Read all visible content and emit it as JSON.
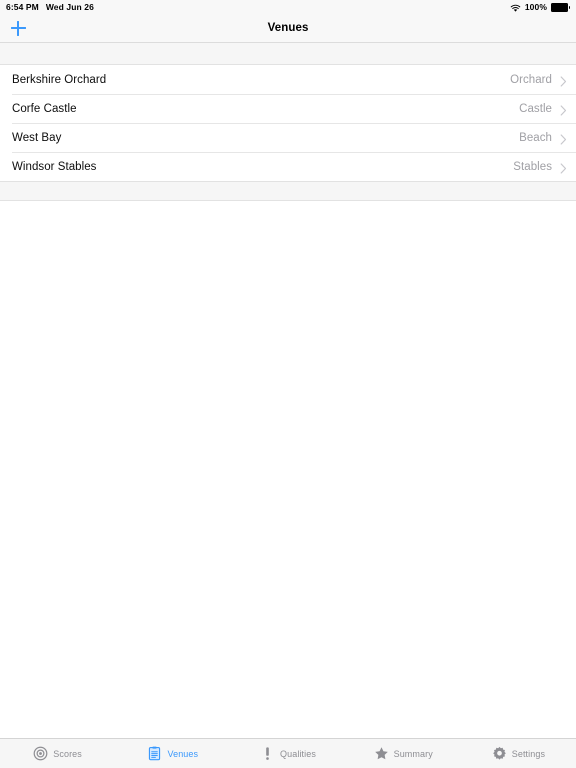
{
  "status_bar": {
    "time": "6:54 PM",
    "date": "Wed Jun 26",
    "wifi_icon": "wifi-icon",
    "battery_percent": "100%",
    "battery_icon": "battery-full-icon"
  },
  "nav_bar": {
    "add_icon": "plus-icon",
    "title": "Venues"
  },
  "list": {
    "rows": [
      {
        "title": "Berkshire Orchard",
        "detail": "Orchard",
        "accessory_icon": "chevron-right-icon"
      },
      {
        "title": "Corfe Castle",
        "detail": "Castle",
        "accessory_icon": "chevron-right-icon"
      },
      {
        "title": "West Bay",
        "detail": "Beach",
        "accessory_icon": "chevron-right-icon"
      },
      {
        "title": "Windsor Stables",
        "detail": "Stables",
        "accessory_icon": "chevron-right-icon"
      }
    ]
  },
  "tab_bar": {
    "selected": "Venues",
    "items": [
      {
        "label": "Scores",
        "icon": "target-icon",
        "active": false
      },
      {
        "label": "Venues",
        "icon": "clipboard-icon",
        "active": true
      },
      {
        "label": "Qualities",
        "icon": "exclamation-icon",
        "active": false
      },
      {
        "label": "Summary",
        "icon": "star-icon",
        "active": false
      },
      {
        "label": "Settings",
        "icon": "gear-icon",
        "active": false
      }
    ]
  },
  "colors": {
    "accent": "#3b99fc",
    "inactive": "#8e8e93",
    "detail_text": "#a0a0a5",
    "bar_background": "#f6f6f6",
    "group_background": "#f6f6f6"
  }
}
